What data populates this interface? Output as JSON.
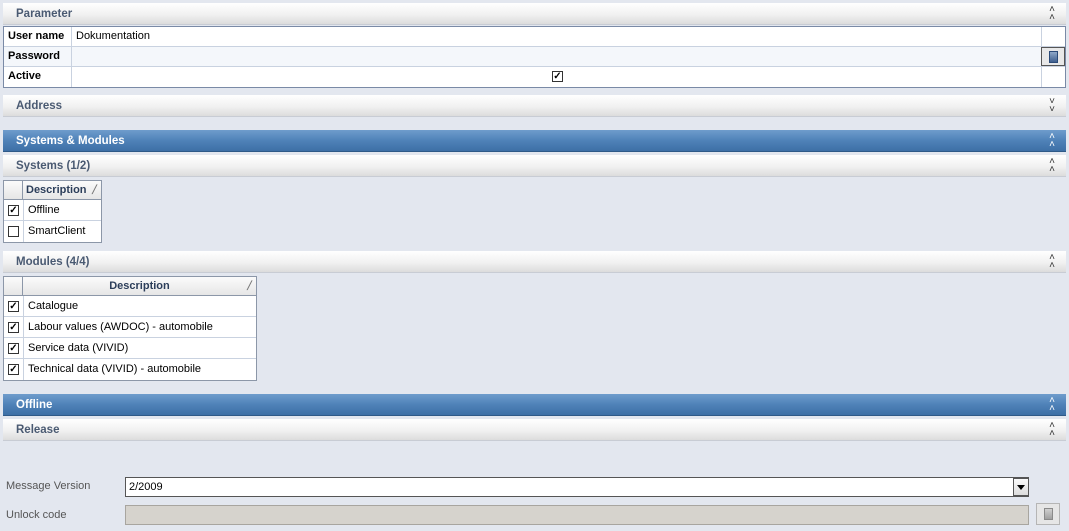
{
  "parameter": {
    "title": "Parameter",
    "rows": [
      {
        "label": "User name",
        "value": "Dokumentation"
      },
      {
        "label": "Password",
        "value": ""
      },
      {
        "label": "Active",
        "checked": true
      }
    ]
  },
  "address": {
    "title": "Address"
  },
  "systems_modules": {
    "title": "Systems & Modules"
  },
  "systems": {
    "title": "Systems (1/2)",
    "column": "Description",
    "rows": [
      {
        "label": "Offline",
        "checked": true
      },
      {
        "label": "SmartClient",
        "checked": false
      }
    ]
  },
  "modules": {
    "title": "Modules (4/4)",
    "column": "Description",
    "rows": [
      {
        "label": "Catalogue",
        "checked": true
      },
      {
        "label": "Labour values (AWDOC) - automobile",
        "checked": true
      },
      {
        "label": "Service data (VIVID)",
        "checked": true
      },
      {
        "label": "Technical data (VIVID) - automobile",
        "checked": true
      }
    ]
  },
  "offline": {
    "title": "Offline"
  },
  "release": {
    "title": "Release",
    "message_version_label": "Message Version",
    "message_version_value": "2/2009",
    "unlock_code_label": "Unlock code",
    "unlock_code_value": ""
  },
  "icons": {
    "collapse": "chevron-double-up-icon",
    "expand": "chevron-double-down-icon",
    "password_button": "keypad-icon",
    "dropdown": "triangle-down-icon"
  },
  "colors": {
    "background": "#e3e7ef",
    "header_blue": "#4f82b8",
    "header_text": "#4a5a72"
  }
}
